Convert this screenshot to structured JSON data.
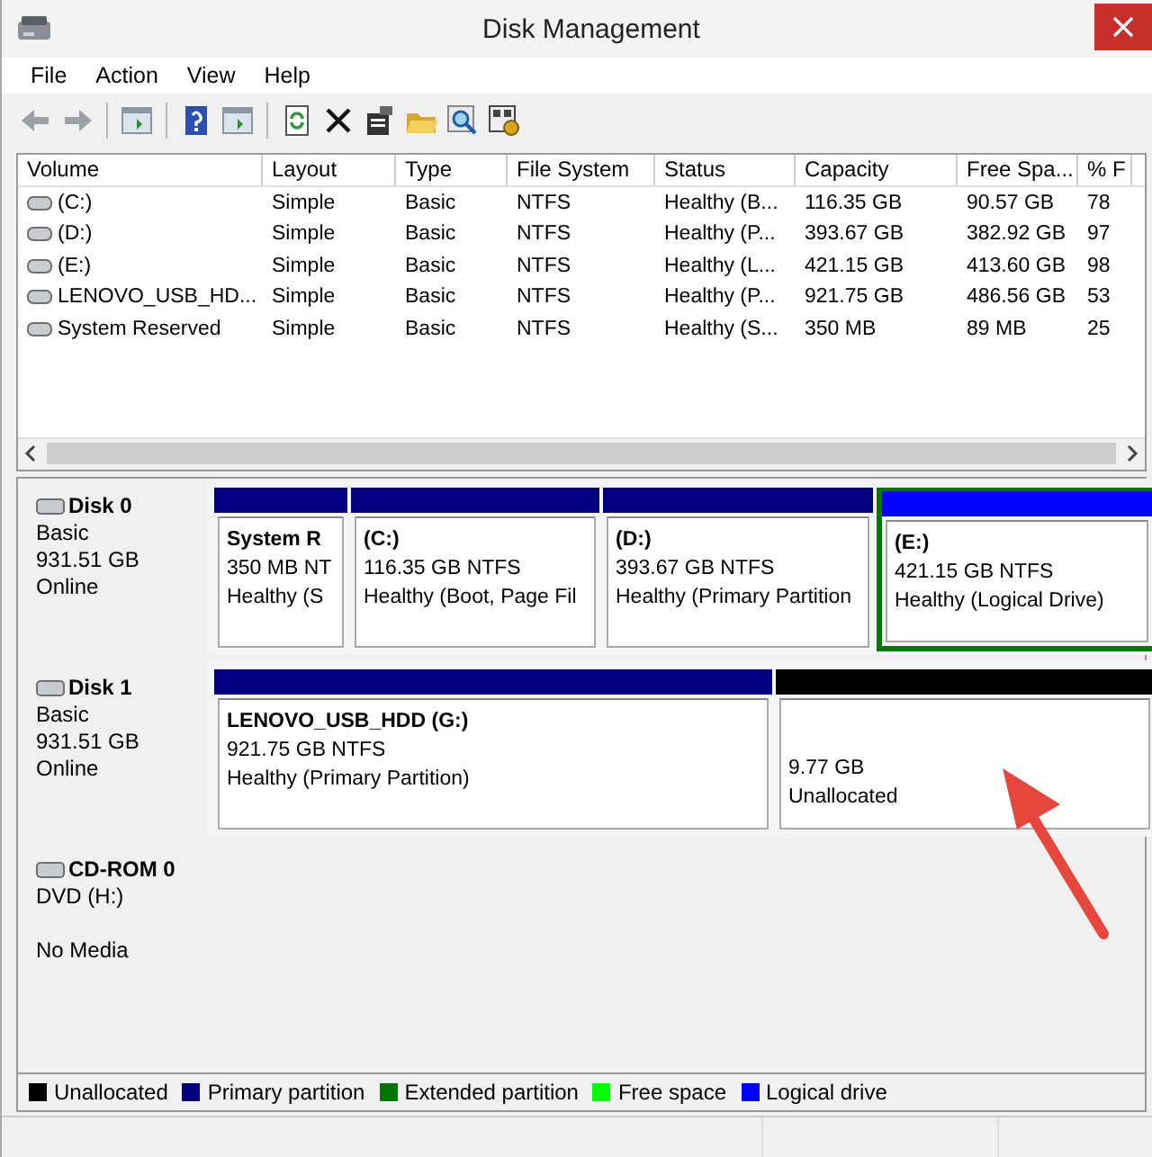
{
  "window": {
    "title": "Disk Management"
  },
  "menu": [
    "File",
    "Action",
    "View",
    "Help"
  ],
  "volumes": {
    "columns": [
      "Volume",
      "Layout",
      "Type",
      "File System",
      "Status",
      "Capacity",
      "Free Spa...",
      "% F"
    ],
    "rows": [
      [
        "(C:)",
        "Simple",
        "Basic",
        "NTFS",
        "Healthy (B...",
        "116.35 GB",
        "90.57 GB",
        "78"
      ],
      [
        "(D:)",
        "Simple",
        "Basic",
        "NTFS",
        "Healthy (P...",
        "393.67 GB",
        "382.92 GB",
        "97"
      ],
      [
        "(E:)",
        "Simple",
        "Basic",
        "NTFS",
        "Healthy (L...",
        "421.15 GB",
        "413.60 GB",
        "98"
      ],
      [
        "LENOVO_USB_HD...",
        "Simple",
        "Basic",
        "NTFS",
        "Healthy (P...",
        "921.75 GB",
        "486.56 GB",
        "53"
      ],
      [
        "System Reserved",
        "Simple",
        "Basic",
        "NTFS",
        "Healthy (S...",
        "350 MB",
        "89 MB",
        "25"
      ]
    ]
  },
  "disks": [
    {
      "name": "Disk 0",
      "type": "Basic",
      "size": "931.51 GB",
      "status": "Online",
      "partitions": [
        {
          "name": "System R",
          "size": "350 MB NT",
          "status": "Healthy (S",
          "color": "#000080",
          "extended": false
        },
        {
          "name": "(C:)",
          "size": "116.35 GB NTFS",
          "status": "Healthy (Boot, Page Fil",
          "color": "#000080",
          "extended": false
        },
        {
          "name": "(D:)",
          "size": "393.67 GB NTFS",
          "status": "Healthy (Primary Partition",
          "color": "#000080",
          "extended": false
        },
        {
          "name": "(E:)",
          "size": "421.15 GB NTFS",
          "status": "Healthy (Logical Drive)",
          "color": "#0000ff",
          "extended": true
        }
      ]
    },
    {
      "name": "Disk 1",
      "type": "Basic",
      "size": "931.51 GB",
      "status": "Online",
      "partitions": [
        {
          "name": "LENOVO_USB_HDD  (G:)",
          "size": "921.75 GB NTFS",
          "status": "Healthy (Primary Partition)",
          "color": "#000080",
          "extended": false
        },
        {
          "size": "9.77 GB",
          "status": "Unallocated",
          "color": "#000000",
          "extended": false
        }
      ]
    },
    {
      "name": "CD-ROM 0",
      "type": "DVD (H:)",
      "status": "No Media"
    }
  ],
  "legend": [
    {
      "label": "Unallocated",
      "color": "#000000"
    },
    {
      "label": "Primary partition",
      "color": "#000080"
    },
    {
      "label": "Extended partition",
      "color": "#007800"
    },
    {
      "label": "Free space",
      "color": "#00ff00"
    },
    {
      "label": "Logical drive",
      "color": "#0000ff"
    }
  ]
}
